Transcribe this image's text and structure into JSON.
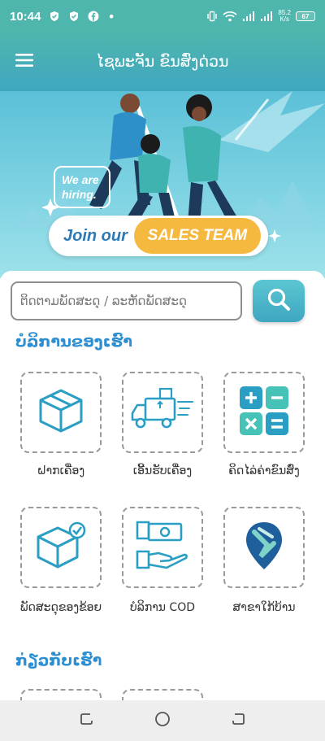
{
  "status_bar": {
    "time": "10:44",
    "net_speed": "85.2",
    "net_unit": "K/s",
    "battery": "67",
    "dot": "•"
  },
  "app_bar": {
    "title": "ໄຊພະຈັນ ຂົນສົ່ງດ່ວນ"
  },
  "banner": {
    "hiring_text": "We are hiring.",
    "join_text": "Join our",
    "sales_text": "SALES TEAM"
  },
  "search": {
    "placeholder": "ຕິດຕາມພັດສະດຸ / ລະຫັດພັດສະດຸ",
    "value": ""
  },
  "services": {
    "title": "ບໍລິການຂອງເຮົາ",
    "items": [
      {
        "label": "ຝາກເຄື່ອງ",
        "icon": "package-box-icon"
      },
      {
        "label": "ເອີ້ນຮັບເຄື່ອງ",
        "icon": "delivery-truck-icon"
      },
      {
        "label": "ຄິດໄລ່ຄ່າຂົນສົ່ງ",
        "icon": "calculator-icon"
      },
      {
        "label": "ພັດສະດຸຂອງຂ້ອຍ",
        "icon": "package-check-icon"
      },
      {
        "label": "ບໍລິການ COD",
        "icon": "cash-on-delivery-icon"
      },
      {
        "label": "ສາຂາໃກ້ບ້ານ",
        "icon": "branch-location-icon"
      }
    ]
  },
  "partners": {
    "title": "ກ່ຽວກັບເຮົາ"
  },
  "colors": {
    "primary": "#4fb6ad",
    "accent_blue": "#2d8fd2",
    "banner_yellow": "#f5b940"
  }
}
